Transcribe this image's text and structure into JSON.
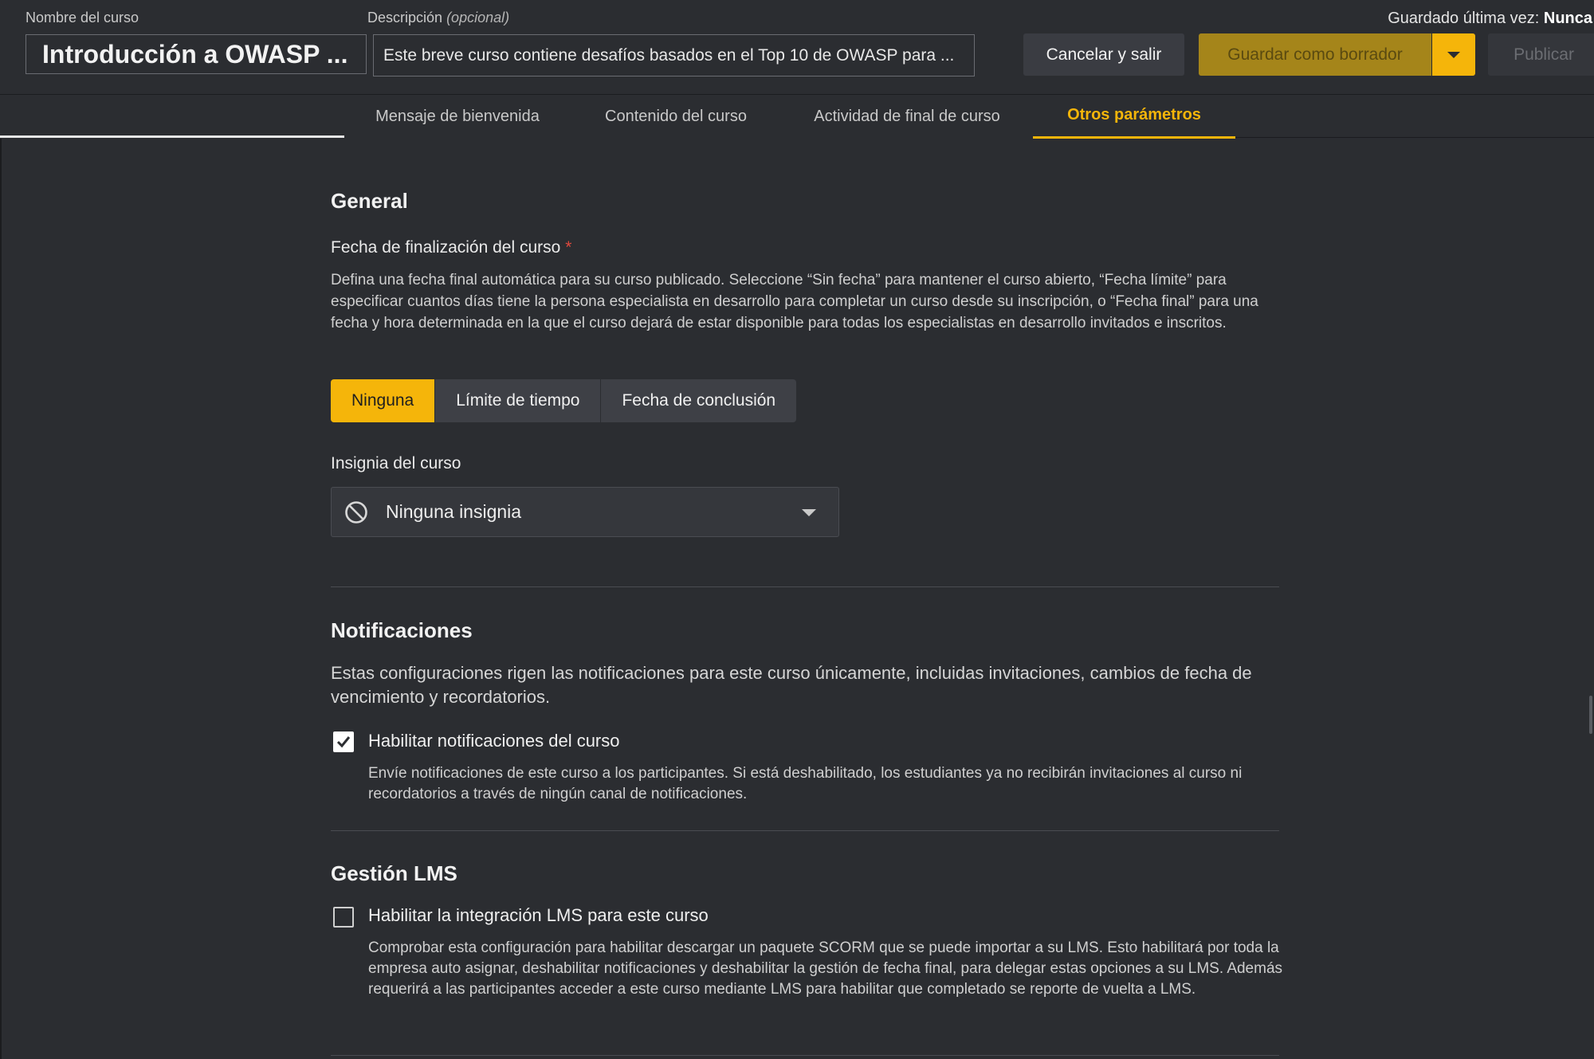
{
  "header": {
    "name_label": "Nombre del curso",
    "name_value": "Introducción a OWASP ...",
    "desc_label": "Descripción",
    "desc_optional": "(opcional)",
    "desc_value": "Este breve curso contiene desafíos basados en el Top 10 de OWASP para ...",
    "cancel_label": "Cancelar y salir",
    "draft_label": "Guardar como borrador",
    "publish_label": "Publicar",
    "saved_label": "Guardado última vez:",
    "saved_value": "Nunca"
  },
  "tabs": [
    {
      "label": "Mensaje de bienvenida"
    },
    {
      "label": "Contenido del curso"
    },
    {
      "label": "Actividad de final de curso"
    },
    {
      "label": "Otros parámetros"
    }
  ],
  "general": {
    "title": "General",
    "end_date_label": "Fecha de finalización del curso",
    "required_mark": "*",
    "end_date_desc": "Defina una fecha final automática para su curso publicado. Seleccione “Sin fecha” para mantener el curso abierto, “Fecha límite” para especificar cuantos días tiene la persona especialista en desarrollo para completar un curso desde su inscripción, o “Fecha final” para una fecha y hora determinada en la que el curso dejará de estar disponible para todas los especialistas en desarrollo invitados e inscritos.",
    "options": [
      "Ninguna",
      "Límite de tiempo",
      "Fecha de conclusión"
    ],
    "badge_label": "Insignia del curso",
    "badge_value": "Ninguna insignia"
  },
  "notifications": {
    "title": "Notificaciones",
    "desc": "Estas configuraciones rigen las notificaciones para este curso únicamente, incluidas invitaciones, cambios de fecha de vencimiento y recordatorios.",
    "checkbox_label": "Habilitar notificaciones del curso",
    "checked": true,
    "checkbox_desc": "Envíe notificaciones de este curso a los participantes. Si está deshabilitado, los estudiantes ya no recibirán invitaciones al curso ni recordatorios a través de ningún canal de notificaciones."
  },
  "lms": {
    "title": "Gestión LMS",
    "checkbox_label": "Habilitar la integración LMS para este curso",
    "checked": false,
    "checkbox_desc": "Comprobar esta configuración para habilitar descargar un paquete SCORM que se puede importar a su LMS. Esto habilitará por toda la empresa auto asignar, deshabilitar notificaciones y deshabilitar la gestión de fecha final, para delegar estas opciones a su LMS. Además requerirá a las participantes acceder a este curso mediante LMS para habilitar que completado se reporte de vuelta a LMS."
  },
  "colors": {
    "accent": "#f5b50a",
    "background": "#2b2d31"
  }
}
